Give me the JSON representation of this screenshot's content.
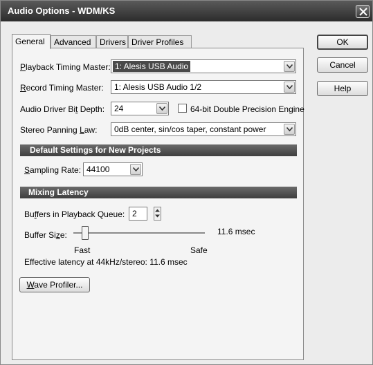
{
  "window": {
    "title": "Audio Options - WDM/KS",
    "close_glyph": "X"
  },
  "tabs": [
    {
      "label": "General",
      "active": true
    },
    {
      "label": "Advanced",
      "active": false
    },
    {
      "label": "Drivers",
      "active": false
    },
    {
      "label": "Driver Profiles",
      "active": false
    }
  ],
  "general": {
    "playback_timing": {
      "mnemonic": "P",
      "label_rest": "layback Timing Master:",
      "value": "1: Alesis USB Audio"
    },
    "record_timing": {
      "mnemonic": "R",
      "label_rest": "ecord Timing Master:",
      "value": "1: Alesis USB Audio 1/2"
    },
    "bit_depth": {
      "label_pre": "Audio Driver Bi",
      "mnemonic": "t",
      "label_post": " Depth:",
      "value": "24"
    },
    "double_precision": {
      "label": "64-bit Double Precision Engine",
      "checked": false
    },
    "panning_law": {
      "label_pre": "Stereo Panning ",
      "mnemonic": "L",
      "label_post": "aw:",
      "value": "0dB center, sin/cos taper, constant power"
    }
  },
  "defaults_section": {
    "title": "Default Settings for New Projects"
  },
  "sampling_rate": {
    "mnemonic": "S",
    "label_rest": "ampling Rate:",
    "value": "44100"
  },
  "latency_section": {
    "title": "Mixing Latency"
  },
  "buffers": {
    "label_pre": "Bu",
    "mnemonic": "f",
    "label_post": "fers in Playback Queue:",
    "value": "2"
  },
  "buffer_size": {
    "label_pre": "Buffer Si",
    "mnemonic": "z",
    "label_post": "e:",
    "value_text": "11.6 msec",
    "slider_position": 0.09,
    "left_caption": "Fast",
    "right_caption": "Safe"
  },
  "effective_latency": "Effective latency at 44kHz/stereo:  11.6 msec",
  "wave_profiler": {
    "mnemonic": "W",
    "label_rest": "ave Profiler..."
  },
  "buttons": {
    "ok": "OK",
    "cancel": "Cancel",
    "help": "Help"
  }
}
